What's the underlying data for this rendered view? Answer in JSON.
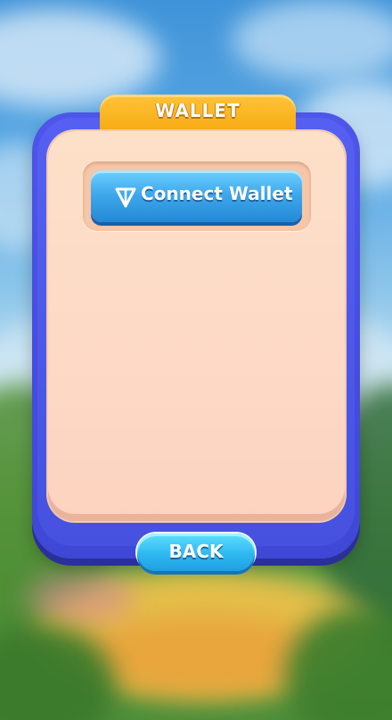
{
  "panel": {
    "title": "WALLET"
  },
  "connect_button": {
    "label": "Connect Wallet",
    "icon": "ton-logo-icon"
  },
  "back_button": {
    "label": "BACK"
  },
  "colors": {
    "panel_border": "#4d56e8",
    "title_tab": "#ffc33a",
    "panel_fill": "#fde0c8",
    "connect_button": "#3fa9ec",
    "back_button": "#2fb8f0"
  }
}
